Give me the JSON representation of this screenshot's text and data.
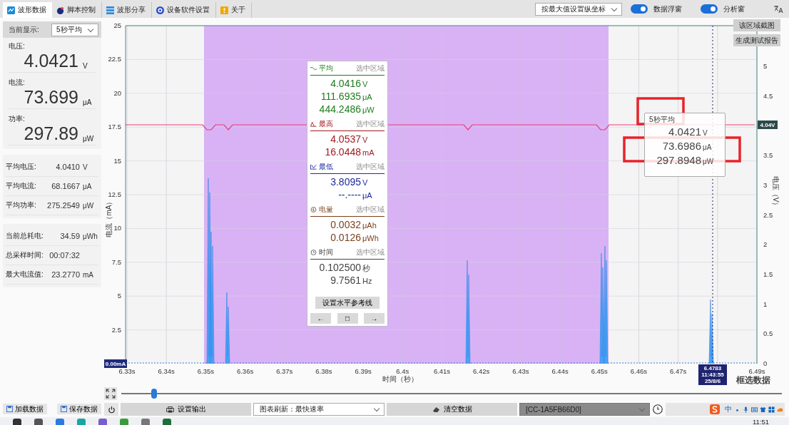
{
  "tabs": [
    {
      "label": "波形数据",
      "selected": true,
      "kind": "wave"
    },
    {
      "label": "脚本控制",
      "selected": false,
      "kind": "script"
    },
    {
      "label": "波形分享",
      "selected": false,
      "kind": "share"
    },
    {
      "label": "设备软件设置",
      "selected": false,
      "kind": "settings"
    },
    {
      "label": "关于",
      "selected": false,
      "kind": "about"
    }
  ],
  "toolbar": {
    "axis_mode": "按最大值设置纵坐标",
    "toggles": [
      {
        "label": "数据浮窗",
        "on": true
      },
      {
        "label": "分析窗",
        "on": true
      }
    ]
  },
  "current_display": {
    "label": "当前显示:",
    "value": "5秒平均"
  },
  "readings": [
    {
      "label": "电压:",
      "value": "4.0421",
      "unit": "V"
    },
    {
      "label": "电流:",
      "value": "73.699",
      "unit": "μA"
    },
    {
      "label": "功率:",
      "value": "297.89",
      "unit": "μW"
    }
  ],
  "averages": [
    {
      "label": "平均电压:",
      "value": "4.0410",
      "unit": "V"
    },
    {
      "label": "平均电流:",
      "value": "68.1667",
      "unit": "μA"
    },
    {
      "label": "平均功率:",
      "value": "275.2549",
      "unit": "μW"
    }
  ],
  "totals": [
    {
      "label": "当前总耗电:",
      "value": "34.59",
      "unit": "μWh"
    },
    {
      "label": "总采样时间:",
      "value": "00:07:32"
    },
    {
      "label": "最大电流值:",
      "value": "23.2770",
      "unit": "mA"
    }
  ],
  "side_buttons": [
    "加载数据",
    "保存数据"
  ],
  "chart": {
    "y_left_title": "电流（mA）",
    "y_right_title": "电压（V）",
    "x_title": "时间（秒）",
    "y_left_ticks": [
      "25",
      "22.5",
      "20",
      "17.5",
      "15",
      "12.5",
      "10",
      "7.5",
      "5",
      "2.5"
    ],
    "y_right_ticks": [
      "5",
      "4.5",
      "3.5",
      "3",
      "2.5",
      "2",
      "1.5",
      "1",
      "0.5",
      "0"
    ],
    "x_ticks": [
      "6.33s",
      "6.34s",
      "6.35s",
      "6.36s",
      "6.37s",
      "6.38s",
      "6.39s",
      "6.4s",
      "6.41s",
      "6.42s",
      "6.43s",
      "6.44s",
      "6.45s",
      "6.46s",
      "6.47s",
      "6.49s"
    ],
    "current_marker": "0.00mA",
    "voltage_marker": "4.04V",
    "cursor_label": [
      "6.4783",
      "11:43:55",
      "25/8/6"
    ],
    "selection_label": "框选数据",
    "buttons": [
      "该区域截图",
      "生成测试报告"
    ]
  },
  "analysis": {
    "sections": [
      {
        "kind": "average",
        "title": "平均",
        "scope": "选中区域",
        "color": "#1e7b1e",
        "values": [
          {
            "value": "4.0416",
            "unit": "V"
          },
          {
            "value": "111.6935",
            "unit": "μA"
          },
          {
            "value": "444.2486",
            "unit": "μW"
          }
        ]
      },
      {
        "kind": "max",
        "title": "最高",
        "scope": "选中区域",
        "color": "#a3191f",
        "values": [
          {
            "value": "4.0537",
            "unit": "V"
          },
          {
            "value": "16.0448",
            "unit": "mA"
          }
        ]
      },
      {
        "kind": "min",
        "title": "最低",
        "scope": "选中区域",
        "color": "#1f2a9e",
        "values": [
          {
            "value": "3.8095",
            "unit": "V"
          },
          {
            "value": "--.----",
            "unit": "μA"
          }
        ]
      },
      {
        "kind": "energy",
        "title": "电量",
        "scope": "选中区域",
        "color": "#7a3f1c",
        "values": [
          {
            "value": "0.0032",
            "unit": "μAh"
          },
          {
            "value": "0.0126",
            "unit": "μWh"
          }
        ]
      },
      {
        "kind": "time",
        "title": "时间",
        "scope": "选中区域",
        "color": "#444444",
        "values": [
          {
            "value": "0.102500",
            "unit": "秒"
          },
          {
            "value": "9.7561",
            "unit": "Hz"
          }
        ]
      }
    ],
    "reference_button": "设置水平参考线",
    "nav_buttons": [
      "←",
      "□",
      "→"
    ]
  },
  "tooltip": {
    "title": "5秒平均",
    "values": [
      {
        "value": "4.0421",
        "unit": "V"
      },
      {
        "value": "73.6986",
        "unit": "μA"
      },
      {
        "value": "297.8948",
        "unit": "μW"
      }
    ]
  },
  "slider": {
    "level": 0.05
  },
  "controls": {
    "output_button": "设置输出",
    "refresh": "图表刷新：最快速率",
    "clear_button": "清空数据",
    "device": "[CC-1A5FB66D0]"
  },
  "ime": {
    "mode": "中"
  },
  "taskbar": {
    "time": "11:51"
  }
}
